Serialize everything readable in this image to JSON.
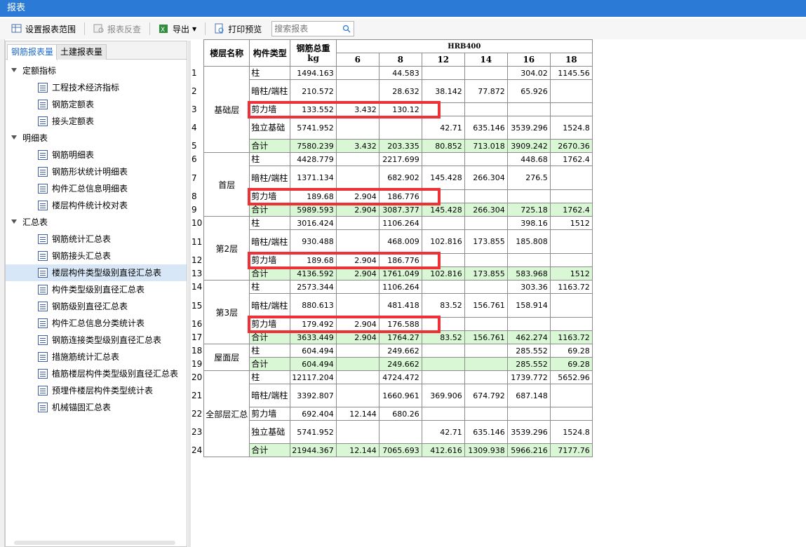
{
  "window": {
    "title": "报表"
  },
  "toolbar": {
    "set_range": "设置报表范围",
    "reverse": "报表反查",
    "export": "导出",
    "print_preview": "打印预览",
    "search_placeholder": "搜索报表"
  },
  "tabs": [
    "钢筋报表量",
    "土建报表量"
  ],
  "tree": [
    {
      "type": "group",
      "label": "定额指标"
    },
    {
      "type": "leaf",
      "label": "工程技术经济指标"
    },
    {
      "type": "leaf",
      "label": "钢筋定额表"
    },
    {
      "type": "leaf",
      "label": "接头定额表"
    },
    {
      "type": "group",
      "label": "明细表"
    },
    {
      "type": "leaf",
      "label": "钢筋明细表"
    },
    {
      "type": "leaf",
      "label": "钢筋形状统计明细表"
    },
    {
      "type": "leaf",
      "label": "构件汇总信息明细表"
    },
    {
      "type": "leaf",
      "label": "楼层构件统计校对表"
    },
    {
      "type": "group",
      "label": "汇总表"
    },
    {
      "type": "leaf",
      "label": "钢筋统计汇总表"
    },
    {
      "type": "leaf",
      "label": "钢筋接头汇总表"
    },
    {
      "type": "leaf",
      "label": "楼层构件类型级别直径汇总表",
      "selected": true
    },
    {
      "type": "leaf",
      "label": "构件类型级别直径汇总表"
    },
    {
      "type": "leaf",
      "label": "钢筋级别直径汇总表"
    },
    {
      "type": "leaf",
      "label": "构件汇总信息分类统计表"
    },
    {
      "type": "leaf",
      "label": "钢筋连接类型级别直径汇总表"
    },
    {
      "type": "leaf",
      "label": "措施筋统计汇总表"
    },
    {
      "type": "leaf",
      "label": "植筋楼层构件类型级别直径汇总表"
    },
    {
      "type": "leaf",
      "label": "预埋件楼层构件类型统计表"
    },
    {
      "type": "leaf",
      "label": "机械锚固汇总表"
    }
  ],
  "report": {
    "headers": {
      "floor": "楼层名称",
      "type": "构件类型",
      "total": "钢筋总重kg",
      "grade": "HRB400"
    },
    "diameters": [
      "6",
      "8",
      "12",
      "14",
      "16",
      "18"
    ],
    "groups": [
      {
        "floor": "基础层",
        "rows": [
          {
            "n": "1",
            "type": "柱",
            "total": "1494.163",
            "vals": [
              "",
              "44.583",
              "",
              "",
              "304.02",
              "1145.56"
            ],
            "h": 19
          },
          {
            "n": "2",
            "type": "暗柱/端柱",
            "total": "210.572",
            "vals": [
              "",
              "28.632",
              "38.142",
              "77.872",
              "65.926",
              ""
            ],
            "h": 33
          },
          {
            "n": "3",
            "type": "剪力墙",
            "total": "133.552",
            "vals": [
              "3.432",
              "130.12",
              "",
              "",
              "",
              ""
            ],
            "h": 19
          },
          {
            "n": "4",
            "type": "独立基础",
            "total": "5741.952",
            "vals": [
              "",
              "",
              "42.71",
              "635.146",
              "3539.296",
              "1524.8"
            ],
            "h": 33
          },
          {
            "n": "5",
            "type": "合计",
            "total": "7580.239",
            "vals": [
              "3.432",
              "203.335",
              "80.852",
              "713.018",
              "3909.242",
              "2670.36"
            ],
            "h": 19,
            "sum": true
          }
        ]
      },
      {
        "floor": "首层",
        "rows": [
          {
            "n": "6",
            "type": "柱",
            "total": "4428.779",
            "vals": [
              "",
              "2217.699",
              "",
              "",
              "448.68",
              "1762.4"
            ],
            "h": 18
          },
          {
            "n": "7",
            "type": "暗柱/端柱",
            "total": "1371.134",
            "vals": [
              "",
              "682.902",
              "145.428",
              "266.304",
              "276.5",
              ""
            ],
            "h": 34
          },
          {
            "n": "8",
            "type": "剪力墙",
            "total": "189.68",
            "vals": [
              "2.904",
              "186.776",
              "",
              "",
              "",
              ""
            ],
            "h": 18
          },
          {
            "n": "9",
            "type": "合计",
            "total": "5989.593",
            "vals": [
              "2.904",
              "3087.377",
              "145.428",
              "266.304",
              "725.18",
              "1762.4"
            ],
            "h": 18,
            "sum": true
          }
        ]
      },
      {
        "floor": "第2层",
        "rows": [
          {
            "n": "10",
            "type": "柱",
            "total": "3016.424",
            "vals": [
              "",
              "1106.264",
              "",
              "",
              "398.16",
              "1512"
            ],
            "h": 18
          },
          {
            "n": "11",
            "type": "暗柱/端柱",
            "total": "930.488",
            "vals": [
              "",
              "468.009",
              "102.816",
              "173.855",
              "185.808",
              ""
            ],
            "h": 34
          },
          {
            "n": "12",
            "type": "剪力墙",
            "total": "189.68",
            "vals": [
              "2.904",
              "186.776",
              "",
              "",
              "",
              ""
            ],
            "h": 19
          },
          {
            "n": "13",
            "type": "合计",
            "total": "4136.592",
            "vals": [
              "2.904",
              "1761.049",
              "102.816",
              "173.855",
              "583.968",
              "1512"
            ],
            "h": 18,
            "sum": true
          }
        ]
      },
      {
        "floor": "第3层",
        "rows": [
          {
            "n": "14",
            "type": "柱",
            "total": "2573.344",
            "vals": [
              "",
              "1106.264",
              "",
              "",
              "303.36",
              "1163.72"
            ],
            "h": 18
          },
          {
            "n": "15",
            "type": "暗柱/端柱",
            "total": "880.613",
            "vals": [
              "",
              "481.418",
              "83.52",
              "156.761",
              "158.914",
              ""
            ],
            "h": 34
          },
          {
            "n": "16",
            "type": "剪力墙",
            "total": "179.492",
            "vals": [
              "2.904",
              "176.588",
              "",
              "",
              "",
              ""
            ],
            "h": 19
          },
          {
            "n": "17",
            "type": "合计",
            "total": "3633.449",
            "vals": [
              "2.904",
              "1764.27",
              "83.52",
              "156.761",
              "462.274",
              "1163.72"
            ],
            "h": 18,
            "sum": true
          }
        ]
      },
      {
        "floor": "屋面层",
        "rows": [
          {
            "n": "18",
            "type": "柱",
            "total": "604.494",
            "vals": [
              "",
              "249.662",
              "",
              "",
              "285.552",
              "69.28"
            ],
            "h": 18
          },
          {
            "n": "19",
            "type": "合计",
            "total": "604.494",
            "vals": [
              "",
              "249.662",
              "",
              "",
              "285.552",
              "69.28"
            ],
            "h": 18,
            "sum": true
          }
        ]
      },
      {
        "floor": "全部层汇总",
        "rows": [
          {
            "n": "20",
            "type": "柱",
            "total": "12117.204",
            "vals": [
              "",
              "4724.472",
              "",
              "",
              "1739.772",
              "5652.96"
            ],
            "h": 18
          },
          {
            "n": "21",
            "type": "暗柱/端柱",
            "total": "3392.807",
            "vals": [
              "",
              "1660.961",
              "369.906",
              "674.792",
              "687.148",
              ""
            ],
            "h": 33
          },
          {
            "n": "22",
            "type": "剪力墙",
            "total": "692.404",
            "vals": [
              "12.144",
              "680.26",
              "",
              "",
              "",
              ""
            ],
            "h": 19
          },
          {
            "n": "23",
            "type": "独立基础",
            "total": "5741.952",
            "vals": [
              "",
              "",
              "42.71",
              "635.146",
              "3539.296",
              "1524.8"
            ],
            "h": 33
          },
          {
            "n": "24",
            "type": "合计",
            "total": "21944.367",
            "vals": [
              "12.144",
              "7065.693",
              "412.616",
              "1309.938",
              "5966.216",
              "7177.76"
            ],
            "h": 19,
            "sum": true
          }
        ]
      }
    ]
  },
  "highlights": [
    "3",
    "8",
    "12",
    "16"
  ],
  "colors": {
    "accent": "#2b7bd6",
    "highlight": "#ee3037",
    "sum_row": "#d9f7d5"
  }
}
